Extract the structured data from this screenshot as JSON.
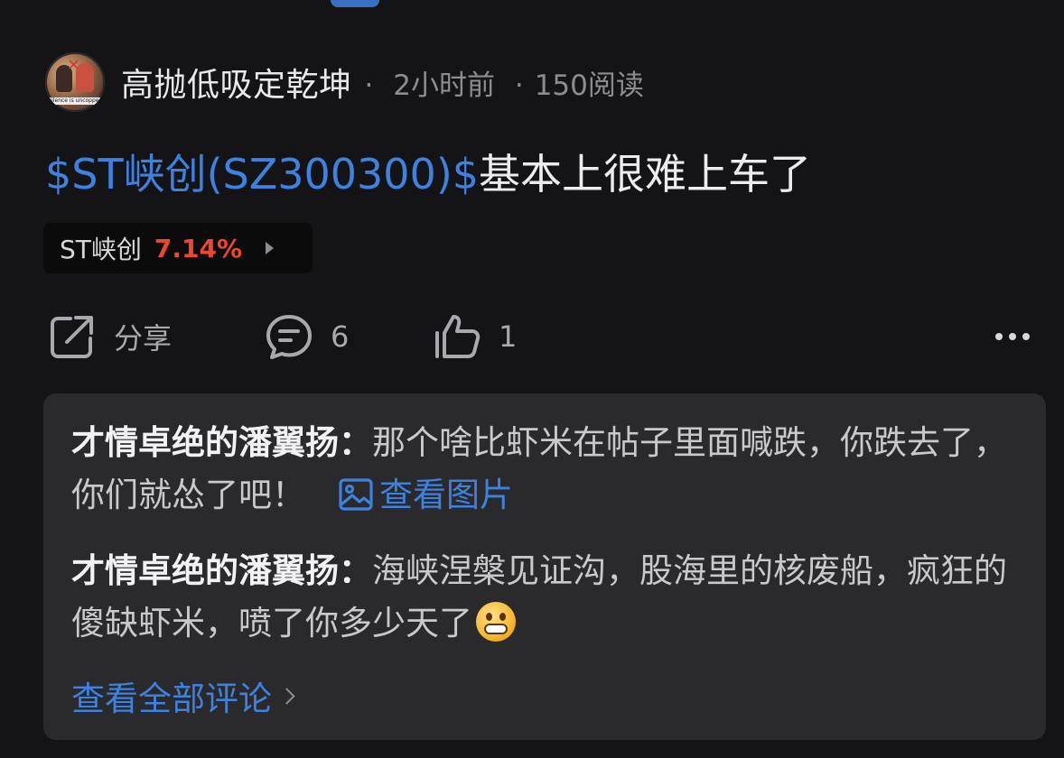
{
  "post": {
    "author": "高抛低吸定乾坤",
    "time": "2小时前",
    "reads": "150阅读",
    "separator": "·",
    "title_tag": "$ST峡创(SZ300300)$",
    "title_text": "基本上很难上车了",
    "avatar_caption": "silence is uncopper"
  },
  "stock": {
    "name": "ST峡创",
    "change": "7.14%",
    "change_color": "#f0452f"
  },
  "actions": {
    "share_label": "分享",
    "comment_count": "6",
    "like_count": "1"
  },
  "comments": [
    {
      "author": "才情卓绝的潘翼扬：",
      "text": "那个啥比虾米在帖子里面喊跌，你跌去了，你们就怂了吧！",
      "link": "查看图片"
    },
    {
      "author": "才情卓绝的潘翼扬：",
      "text": "海峡涅槃见证沟，股海里的核废船，疯狂的傻缺虾米，喷了你多少天了",
      "emoji": "grimacing-face"
    }
  ],
  "view_all_label": "查看全部评论",
  "colors": {
    "background": "#141416",
    "accent": "#3d82e0",
    "card": "#2a2a2d"
  }
}
